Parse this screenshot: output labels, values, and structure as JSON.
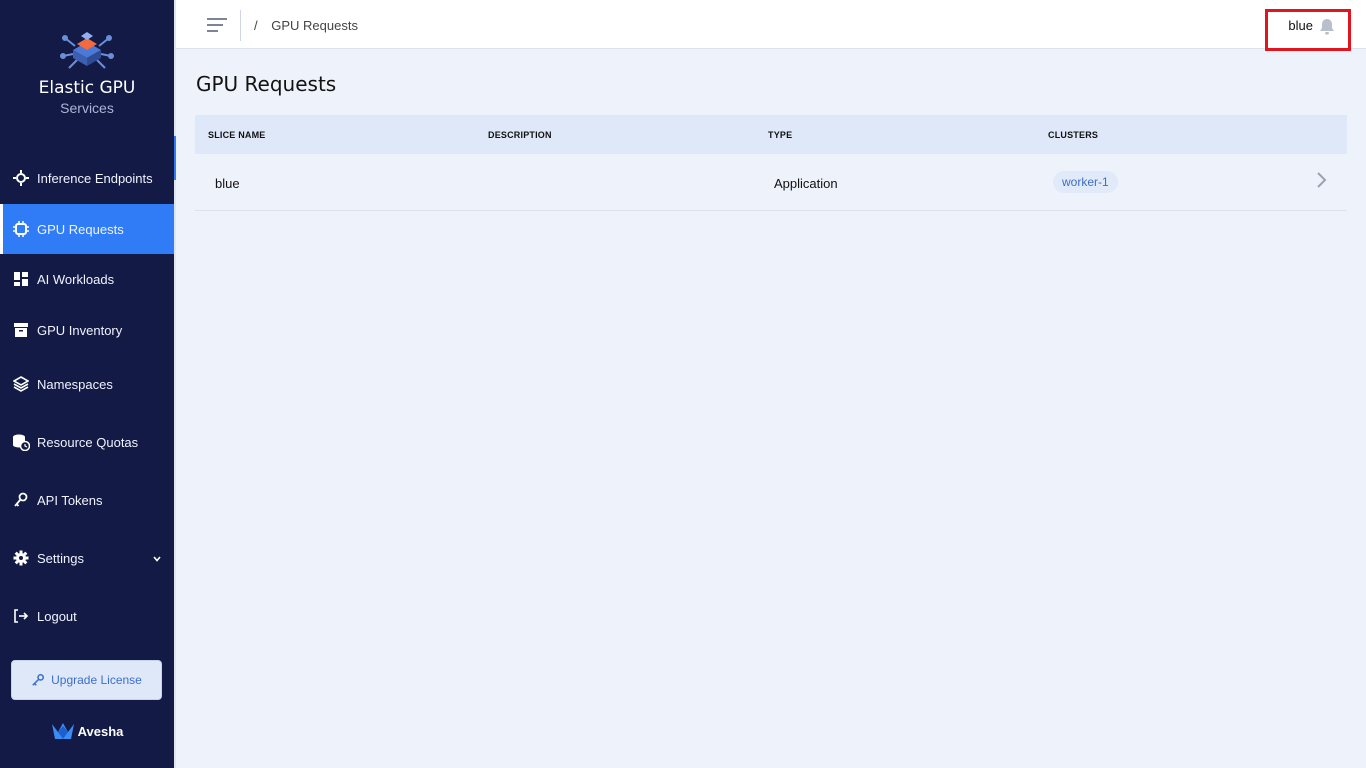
{
  "brand": {
    "title": "Elastic GPU",
    "subtitle": "Services",
    "footer": "Avesha"
  },
  "sidebar": {
    "items": [
      {
        "label": "Inference Endpoints",
        "icon": "cog-icon"
      },
      {
        "label": "GPU Requests",
        "icon": "chip-icon",
        "active": true
      },
      {
        "label": "AI Workloads",
        "icon": "dashboard-icon"
      },
      {
        "label": "GPU Inventory",
        "icon": "archive-icon"
      },
      {
        "label": "Namespaces",
        "icon": "layers-icon"
      },
      {
        "label": "Resource Quotas",
        "icon": "coins-clock-icon"
      },
      {
        "label": "API Tokens",
        "icon": "key-icon"
      },
      {
        "label": "Settings",
        "icon": "gear-icon"
      },
      {
        "label": "Logout",
        "icon": "logout-icon"
      }
    ],
    "upgrade_label": "Upgrade License"
  },
  "header": {
    "breadcrumb_sep": "/",
    "breadcrumb_current": "GPU Requests",
    "user": "blue"
  },
  "main": {
    "title": "GPU Requests",
    "columns": [
      "SLICE NAME",
      "DESCRIPTION",
      "TYPE",
      "CLUSTERS"
    ],
    "rows": [
      {
        "slice_name": "blue",
        "description": "",
        "type": "Application",
        "clusters": [
          "worker-1"
        ]
      }
    ]
  },
  "colors": {
    "sidebar_bg": "#121a45",
    "accent": "#2f7cf6",
    "page_bg": "#eef3fb",
    "highlight_border": "#e2141f"
  }
}
